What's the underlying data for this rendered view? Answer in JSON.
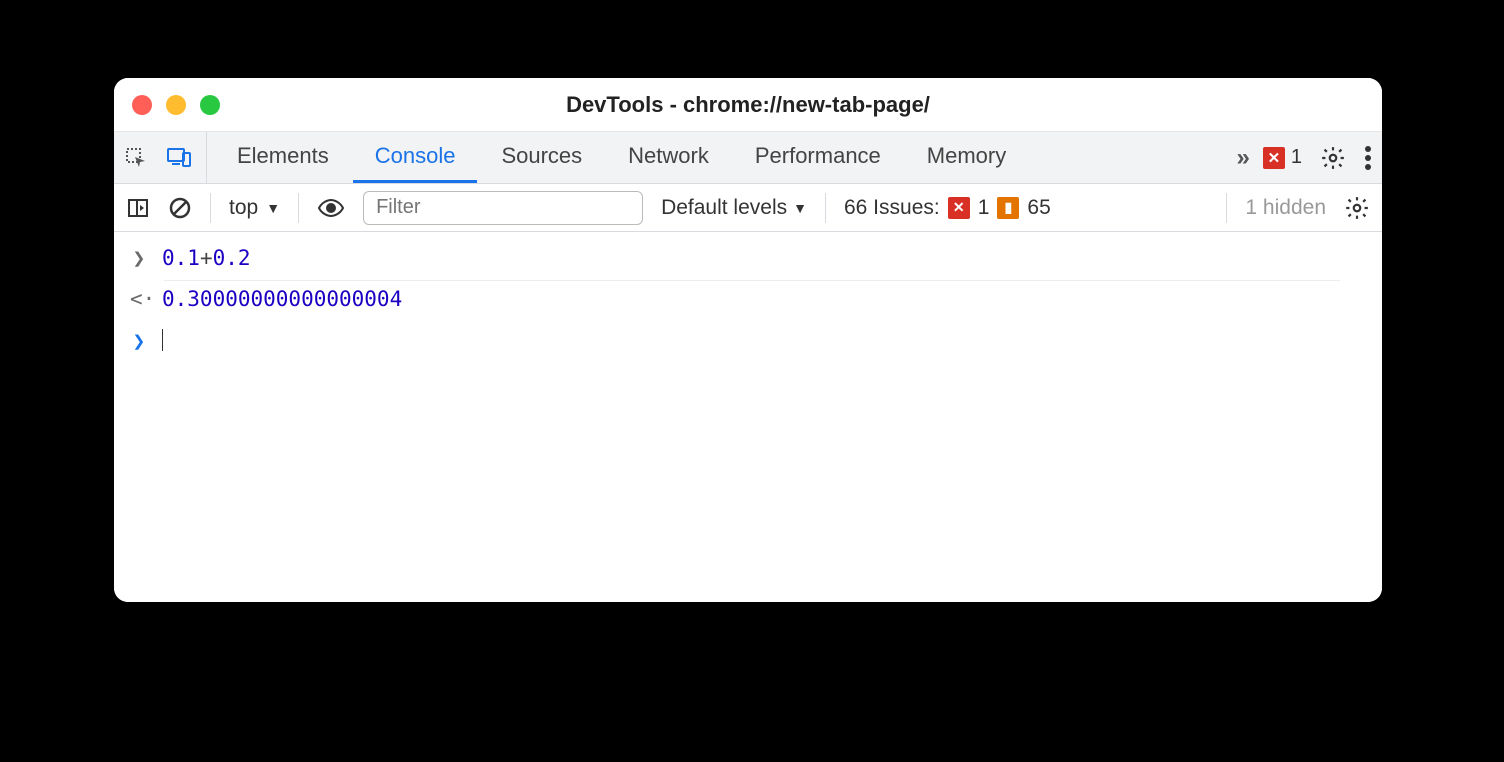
{
  "window": {
    "title": "DevTools - chrome://new-tab-page/"
  },
  "tabs": {
    "items": [
      {
        "label": "Elements"
      },
      {
        "label": "Console"
      },
      {
        "label": "Sources"
      },
      {
        "label": "Network"
      },
      {
        "label": "Performance"
      },
      {
        "label": "Memory"
      }
    ],
    "active_index": 1,
    "error_badge_count": "1"
  },
  "console_toolbar": {
    "context_label": "top",
    "filter_placeholder": "Filter",
    "levels_label": "Default levels",
    "issues_label": "66 Issues:",
    "issues_error_count": "1",
    "issues_warn_count": "65",
    "hidden_label": "1 hidden"
  },
  "console": {
    "input_parts": {
      "a": "0.1",
      "op": "+",
      "b": "0.2"
    },
    "result": "0.30000000000000004"
  }
}
